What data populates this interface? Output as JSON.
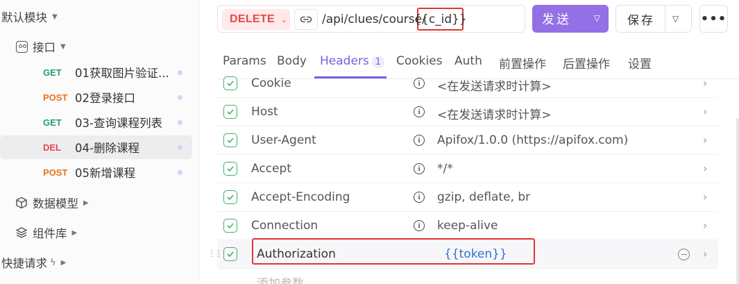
{
  "sidebar": {
    "module_label": "默认模块",
    "folder_label": "接口",
    "apis": [
      {
        "method": "GET",
        "name": "01获取图片验证..."
      },
      {
        "method": "POST",
        "name": "02登录接口"
      },
      {
        "method": "GET",
        "name": "03-查询课程列表"
      },
      {
        "method": "DEL",
        "name": "04-删除课程"
      },
      {
        "method": "POST",
        "name": "05新增课程"
      }
    ],
    "data_model_label": "数据模型",
    "components_label": "组件库",
    "quick_request_label": "快捷请求"
  },
  "request": {
    "method": "DELETE",
    "url_base": "/api/clues/course/",
    "url_param": "{{c_id}}",
    "send_label": "发送",
    "save_label": "保存",
    "more_label": "•••"
  },
  "tabs": [
    {
      "label": "Params"
    },
    {
      "label": "Body"
    },
    {
      "label": "Headers",
      "badge": "1"
    },
    {
      "label": "Cookies"
    },
    {
      "label": "Auth"
    },
    {
      "label": "前置操作"
    },
    {
      "label": "后置操作"
    },
    {
      "label": "设置"
    }
  ],
  "headers": [
    {
      "key": "Cookie",
      "value": "<在发送请求时计算>"
    },
    {
      "key": "Host",
      "value": "<在发送请求时计算>"
    },
    {
      "key": "User-Agent",
      "value": "Apifox/1.0.0 (https://apifox.com)"
    },
    {
      "key": "Accept",
      "value": "*/*"
    },
    {
      "key": "Accept-Encoding",
      "value": "gzip, deflate, br"
    },
    {
      "key": "Connection",
      "value": "keep-alive"
    },
    {
      "key": "Authorization",
      "value": "{{token}}"
    }
  ],
  "add_param_label": "添加参数",
  "colors": {
    "accent": "#7b5ee0",
    "send_button": "#9370e5",
    "delete_method": "#e5484d",
    "get_method": "#22a06b",
    "post_method": "#e8721c",
    "checkbox": "#3fb16b",
    "annotation_box": "#e03535",
    "token_var": "#2f6fd6"
  },
  "icons": {
    "folder": "folder-icon",
    "data_model": "cube-icon",
    "components": "layers-icon",
    "link": "link-icon",
    "header_info": "info-icon",
    "checkbox": "check-icon",
    "row_expand": "chevron-right-icon",
    "remove_row": "minus-circle-icon",
    "drag": "drag-handle-icon"
  }
}
